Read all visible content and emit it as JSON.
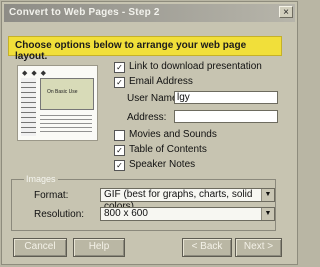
{
  "window": {
    "title": "Convert to Web Pages - Step 2",
    "close_glyph": "×"
  },
  "banner": {
    "text": "Choose options below to arrange your web page layout."
  },
  "preview": {
    "slide_title": "On Basic Use",
    "nav_glyphs": "◆ ◆ ◆"
  },
  "options": [
    {
      "label": "Link to download presentation",
      "checked": true
    },
    {
      "label": "Email Address",
      "checked": true
    },
    {
      "label": "Movies and Sounds",
      "checked": false
    },
    {
      "label": "Table of Contents",
      "checked": true
    },
    {
      "label": "Speaker Notes",
      "checked": true
    }
  ],
  "fields": {
    "user_name": {
      "label": "User Name:",
      "value": "lgy"
    },
    "address": {
      "label": "Address:",
      "value": ""
    }
  },
  "images": {
    "legend": "Images",
    "format": {
      "label": "Format:",
      "value": "GIF (best for graphs, charts, solid colors)"
    },
    "resolution": {
      "label": "Resolution:",
      "value": "800 x 600"
    }
  },
  "buttons": {
    "cancel": "Cancel",
    "help": "Help",
    "back": "< Back",
    "next": "Next >"
  },
  "colors": {
    "banner": "#f1df3a",
    "dialog": "#c7c4b1",
    "titlebar": "#8d8c86"
  }
}
